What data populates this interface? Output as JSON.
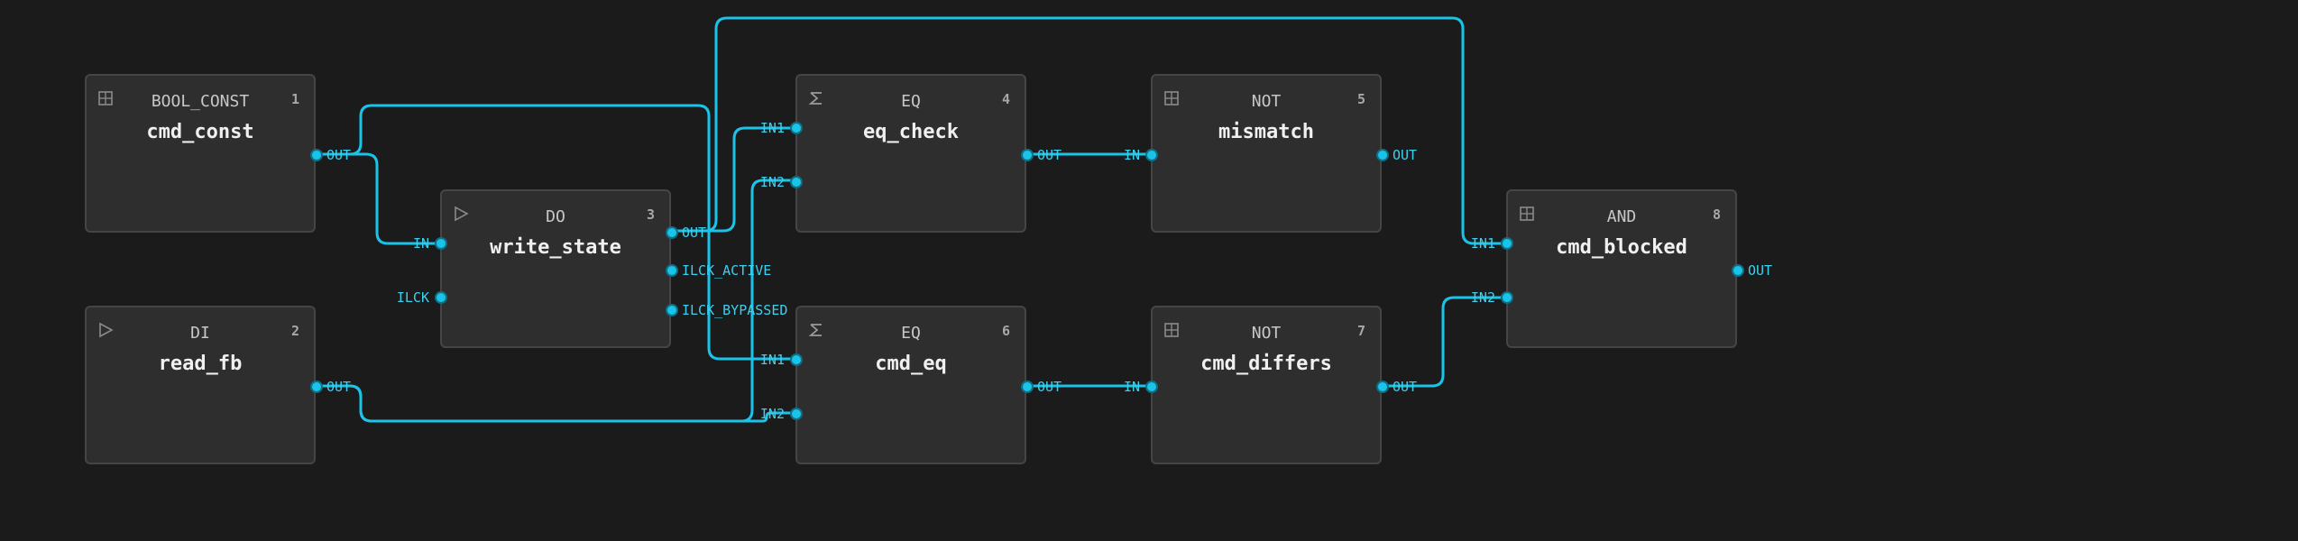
{
  "colors": {
    "background": "#1b1b1b",
    "node_fill": "#2e2e2e",
    "node_border": "#454545",
    "wire": "#19c4e8",
    "port_label": "#3fcfee"
  },
  "nodes": [
    {
      "id": "n1",
      "type": "BOOL_CONST",
      "title": "cmd_const",
      "index": "1",
      "icon": "grid-icon",
      "inputs": [],
      "outputs": [
        {
          "label": "OUT"
        }
      ]
    },
    {
      "id": "n2",
      "type": "DI",
      "title": "read_fb",
      "index": "2",
      "icon": "play-triangle-icon",
      "inputs": [],
      "outputs": [
        {
          "label": "OUT"
        }
      ]
    },
    {
      "id": "n3",
      "type": "DO",
      "title": "write_state",
      "index": "3",
      "icon": "play-triangle-icon",
      "inputs": [
        {
          "label": "IN"
        },
        {
          "label": "ILCK"
        }
      ],
      "outputs": [
        {
          "label": "OUT"
        },
        {
          "label": "ILCK_ACTIVE"
        },
        {
          "label": "ILCK_BYPASSED"
        }
      ]
    },
    {
      "id": "n4",
      "type": "EQ",
      "title": "eq_check",
      "index": "4",
      "icon": "sigma-icon",
      "inputs": [
        {
          "label": "IN1"
        },
        {
          "label": "IN2"
        }
      ],
      "outputs": [
        {
          "label": "OUT"
        }
      ]
    },
    {
      "id": "n5",
      "type": "NOT",
      "title": "mismatch",
      "index": "5",
      "icon": "grid-icon",
      "inputs": [
        {
          "label": "IN"
        }
      ],
      "outputs": [
        {
          "label": "OUT"
        }
      ]
    },
    {
      "id": "n6",
      "type": "EQ",
      "title": "cmd_eq",
      "index": "6",
      "icon": "sigma-icon",
      "inputs": [
        {
          "label": "IN1"
        },
        {
          "label": "IN2"
        }
      ],
      "outputs": [
        {
          "label": "OUT"
        }
      ]
    },
    {
      "id": "n7",
      "type": "NOT",
      "title": "cmd_differs",
      "index": "7",
      "icon": "grid-icon",
      "inputs": [
        {
          "label": "IN"
        }
      ],
      "outputs": [
        {
          "label": "OUT"
        }
      ]
    },
    {
      "id": "n8",
      "type": "AND",
      "title": "cmd_blocked",
      "index": "8",
      "icon": "grid-icon",
      "inputs": [
        {
          "label": "IN1"
        },
        {
          "label": "IN2"
        }
      ],
      "outputs": [
        {
          "label": "OUT"
        }
      ]
    }
  ],
  "connections": [
    {
      "from": "n1.OUT",
      "to": "n3.IN"
    },
    {
      "from": "n1.OUT",
      "to": "n6.IN1"
    },
    {
      "from": "n2.OUT",
      "to": "n4.IN2"
    },
    {
      "from": "n2.OUT",
      "to": "n6.IN2"
    },
    {
      "from": "n3.OUT",
      "to": "n4.IN1"
    },
    {
      "from": "n3.OUT",
      "to": "n8.IN1"
    },
    {
      "from": "n4.OUT",
      "to": "n5.IN"
    },
    {
      "from": "n6.OUT",
      "to": "n7.IN"
    },
    {
      "from": "n7.OUT",
      "to": "n8.IN2"
    }
  ]
}
